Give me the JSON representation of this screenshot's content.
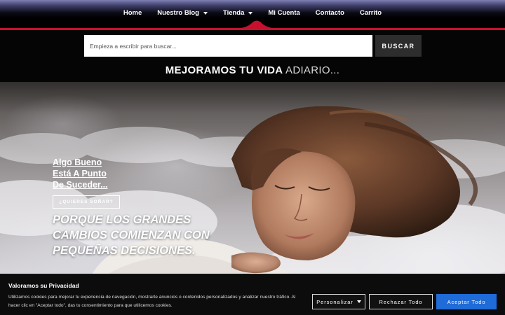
{
  "nav": {
    "items": [
      {
        "label": "Home",
        "has_caret": false
      },
      {
        "label": "Nuestro Blog",
        "has_caret": true
      },
      {
        "label": "Tienda",
        "has_caret": true
      },
      {
        "label": "Mi Cuenta",
        "has_caret": false,
        "active": true
      },
      {
        "label": "Contacto",
        "has_caret": false
      },
      {
        "label": "Carrito",
        "has_caret": false
      }
    ],
    "accent_color": "#c8102e"
  },
  "search": {
    "placeholder": "Empieza a escribir para buscar...",
    "button_label": "BUSCAR"
  },
  "tagline": {
    "part1": "MEJORAMOS TU VIDA",
    "part2": "ADIARIO..."
  },
  "hero": {
    "link_lines": [
      "Algo Bueno",
      "Está A Punto",
      "De Suceder..."
    ],
    "cta_label": "¿QUIERES SOÑAR?",
    "quote_lines": [
      "PORQUE LOS GRANDES",
      "CAMBIOS COMIENZAN CON",
      "PEQUEÑAS DECISIONES."
    ],
    "quote_color": "#f4f4e6"
  },
  "cookie": {
    "title": "Valoramos su Privacidad",
    "text": "Utilizamos cookies para mejorar tu experiencia de navegación, mostrarte anuncios o contenidos personalizados y analizar nuestro tráfico. Al hacer clic en \"Aceptar todo\", das tu consentimiento para que utilicemos cookies.",
    "customize_label": "Personalizar",
    "reject_label": "Rechazar Todo",
    "accept_label": "Aceptar Todo",
    "accept_color": "#1f6bd8"
  }
}
